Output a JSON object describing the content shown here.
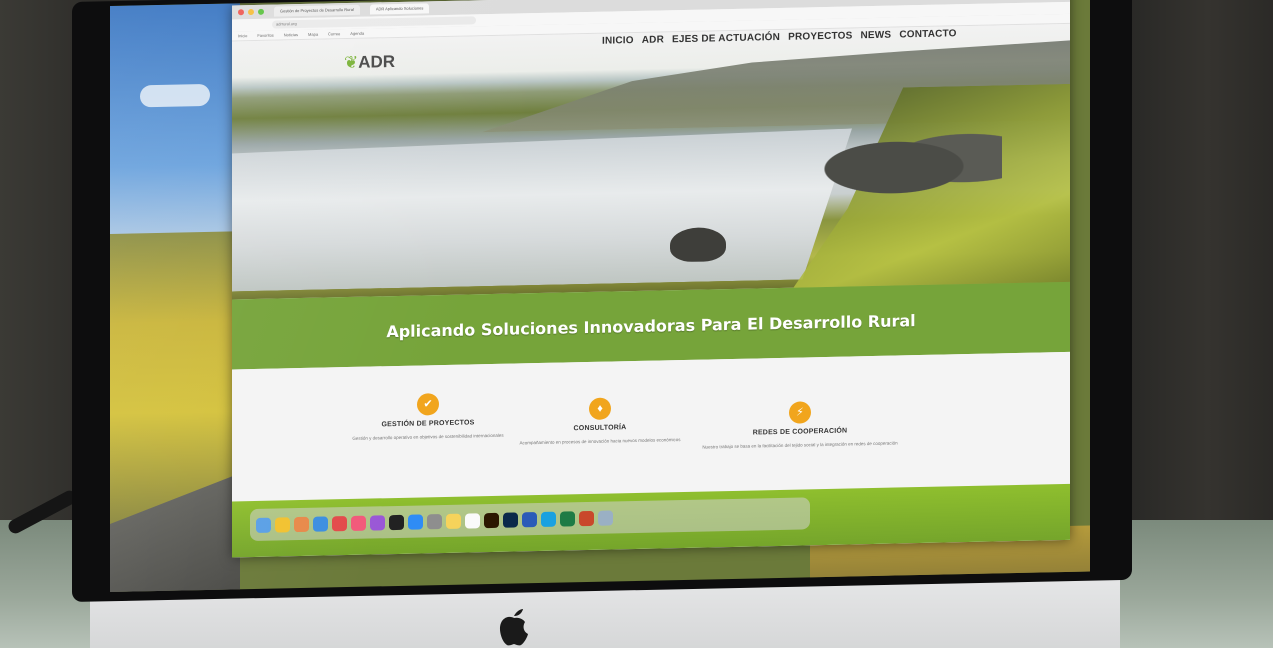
{
  "browser": {
    "tabs": [
      {
        "label": "Gestión de Proyectos de Desarrollo Rural"
      },
      {
        "label": "ADR Aplicando Soluciones"
      }
    ],
    "url": "adrrural.org",
    "bookmarks": [
      "Inicio",
      "Favoritos",
      "Noticias",
      "Mapa",
      "Correo",
      "Agenda"
    ]
  },
  "site": {
    "logo_text": "ADR",
    "nav": [
      "INICIO",
      "ADR",
      "EJES DE ACTUACIÓN",
      "PROYECTOS",
      "NEWS",
      "CONTACTO"
    ],
    "banner_text": "Aplicando Soluciones Innovadoras Para El Desarrollo Rural",
    "services": [
      {
        "title": "GESTIÓN DE PROYECTOS",
        "icon": "check-icon",
        "desc": "Gestión y desarrollo operativo en objetivos de sostenibilidad internacionales"
      },
      {
        "title": "CONSULTORÍA",
        "icon": "diamond-icon",
        "desc": "Acompañamiento en procesos de innovación hacia nuevos modelos económicos"
      },
      {
        "title": "REDES DE COOPERACIÓN",
        "icon": "bolt-icon",
        "desc": "Nuestro trabajo se basa en la facilitación del tejido social y la integración en redes de cooperación"
      }
    ]
  },
  "colors": {
    "brand_green": "#76a43a",
    "accent_orange": "#f1a51d"
  },
  "dock": [
    "finder-icon",
    "chrome-icon",
    "photos-icon",
    "safari-icon",
    "calendar-icon",
    "music-icon",
    "podcasts-icon",
    "tv-icon",
    "appstore-icon",
    "settings-icon",
    "notes-icon",
    "illustrator-icon",
    "photoshop-icon",
    "word-icon",
    "skype-icon",
    "excel-icon",
    "powerpoint-icon",
    "preview-icon",
    "trash-icon"
  ]
}
